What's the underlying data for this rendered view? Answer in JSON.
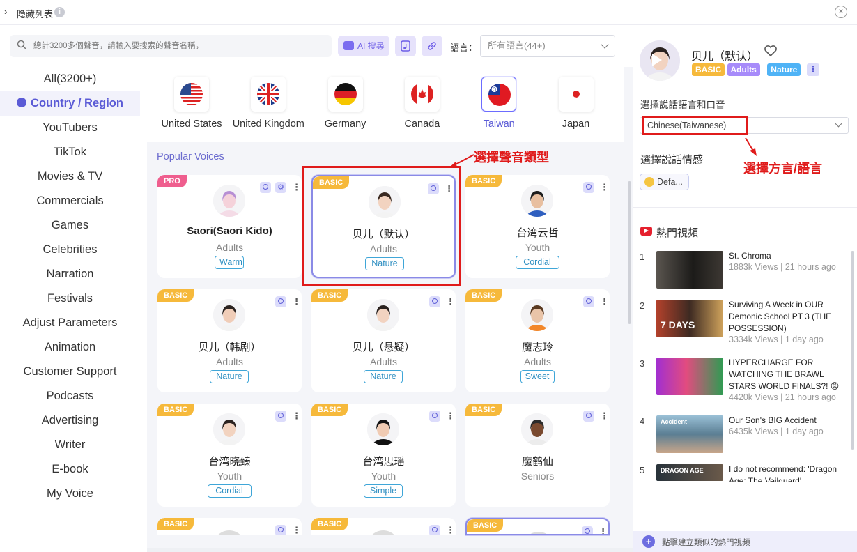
{
  "titlebar": {
    "title": "隐藏列表",
    "info": "i",
    "close": "×",
    "chevron": "›"
  },
  "search": {
    "placeholder": "總計3200多個聲音，請輸入要搜索的聲音名稱，",
    "ai_label": "AI 搜尋"
  },
  "language": {
    "label": "語言：",
    "selected": "所有語言(44+)"
  },
  "sidebar": {
    "items": [
      "All(3200+)",
      "Country / Region",
      "YouTubers",
      "TikTok",
      "Movies & TV",
      "Commercials",
      "Games",
      "Celebrities",
      "Narration",
      "Festivals",
      "Adjust Parameters",
      "Animation",
      "Customer Support",
      "Podcasts",
      "Advertising",
      "Writer",
      "E-book",
      "My Voice"
    ],
    "active_index": 1
  },
  "countries": [
    {
      "name": "United States",
      "selected": false
    },
    {
      "name": "United Kingdom",
      "selected": false
    },
    {
      "name": "Germany",
      "selected": false
    },
    {
      "name": "Canada",
      "selected": false
    },
    {
      "name": "Taiwan",
      "selected": true
    },
    {
      "name": "Japan",
      "selected": false
    }
  ],
  "section_title": "Popular Voices",
  "voices": [
    {
      "badge": "PRO",
      "name": "Saori(Saori Kido)",
      "age": "Adults",
      "tag": "Warm"
    },
    {
      "badge": "BASIC",
      "name": "贝儿（默认）",
      "age": "Adults",
      "tag": "Nature"
    },
    {
      "badge": "BASIC",
      "name": "台湾云哲",
      "age": "Youth",
      "tag": "Cordial"
    },
    {
      "badge": "BASIC",
      "name": "贝儿（韩剧）",
      "age": "Adults",
      "tag": "Nature"
    },
    {
      "badge": "BASIC",
      "name": "贝儿（悬疑）",
      "age": "Adults",
      "tag": "Nature"
    },
    {
      "badge": "BASIC",
      "name": "魔志玲",
      "age": "Adults",
      "tag": "Sweet"
    },
    {
      "badge": "BASIC",
      "name": "台湾晓臻",
      "age": "Youth",
      "tag": "Cordial"
    },
    {
      "badge": "BASIC",
      "name": "台湾思瑶",
      "age": "Youth",
      "tag": "Simple"
    },
    {
      "badge": "BASIC",
      "name": "魔鹤仙",
      "age": "Seniors",
      "tag": ""
    },
    {
      "badge": "BASIC",
      "name": "",
      "age": "",
      "tag": ""
    },
    {
      "badge": "BASIC",
      "name": "",
      "age": "",
      "tag": ""
    },
    {
      "badge": "BASIC",
      "name": "",
      "age": "",
      "tag": ""
    }
  ],
  "annotations": {
    "voice_type": "選擇聲音類型",
    "dialect": "選擇方言/語言"
  },
  "detail": {
    "name": "贝儿（默认）",
    "tags": [
      "BASIC",
      "Adults",
      "Nature"
    ],
    "tag_colors": [
      "#f6b93b",
      "#a78bfa",
      "#4fb3f6"
    ],
    "more": "⋮",
    "lang_label": "選擇說話語言和口音",
    "lang_value": "Chinese(Taiwanese)",
    "emotion_label": "選擇說話情感",
    "emotion_value": "Defa..."
  },
  "videos": {
    "title": "熱門視頻",
    "items": [
      {
        "num": "1",
        "title": "St. Chroma",
        "meta": "1883k Views | 21 hours ago"
      },
      {
        "num": "2",
        "title": "Surviving A Week in OUR Demonic School PT 3 (THE POSSESSION)",
        "meta": "3334k Views | 1 day ago"
      },
      {
        "num": "3",
        "title": "HYPERCHARGE FOR WATCHING THE BRAWL STARS WORLD FINALS?! 😡",
        "meta": "4420k Views | 21 hours ago"
      },
      {
        "num": "4",
        "title": "Our Son's BIG Accident",
        "meta": "6435k Views | 1 day ago"
      },
      {
        "num": "5",
        "title": "I do not recommend: 'Dragon Age: The Veilguard'",
        "meta": ""
      }
    ],
    "thumb_texts": [
      "",
      "7 DAYS",
      "",
      "Accident",
      "DRAGON AGE"
    ],
    "create_similar": "點擊建立類似的熱門視頻"
  },
  "colors": {
    "accent": "#5b5bd6",
    "annotation": "#e01b1b",
    "badge_basic": "#f6b93b",
    "badge_pro": "#ef5e8e"
  },
  "icons": [
    "search-icon",
    "robot-icon",
    "music-file-icon",
    "link-icon",
    "heart-icon",
    "youtube-icon",
    "plus-icon",
    "close-icon",
    "play-icon",
    "globe-icon"
  ]
}
